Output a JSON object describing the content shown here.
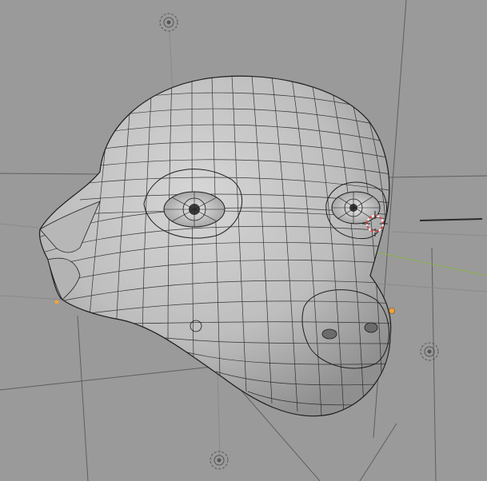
{
  "app": "3D viewport",
  "scene": {
    "object": "creature-head-wireframe",
    "background_color": "#9a9a9a",
    "mesh_color": "#c4c4c4",
    "wire_color": "#1e1e1e",
    "grid_line_color": "#6f6f6f",
    "empty_color": "#555555",
    "axis_green_color": "#8bb34a",
    "origin_color": "#f2a23a",
    "cursor_colors": [
      "#d94a4a",
      "#ffffff"
    ]
  },
  "overlays": {
    "empties": [
      "light-empty-icon",
      "light-empty-icon",
      "light-empty-icon"
    ],
    "origin": "object-origin-dot",
    "cursor": "3d-cursor-icon"
  }
}
